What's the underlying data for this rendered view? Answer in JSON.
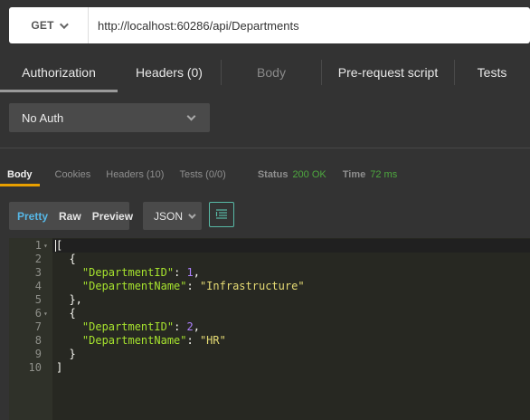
{
  "request": {
    "method": "GET",
    "url": "http://localhost:60286/api/Departments"
  },
  "request_tabs": [
    {
      "label": "Authorization",
      "state": "active"
    },
    {
      "label": "Headers (0)",
      "state": "normal"
    },
    {
      "label": "Body",
      "state": "disabled"
    },
    {
      "label": "Pre-request script",
      "state": "normal"
    },
    {
      "label": "Tests",
      "state": "normal"
    }
  ],
  "auth": {
    "selected": "No Auth"
  },
  "response_tabs": [
    {
      "label": "Body",
      "state": "active"
    },
    {
      "label": "Cookies",
      "state": "normal"
    },
    {
      "label": "Headers (10)",
      "state": "normal"
    },
    {
      "label": "Tests (0/0)",
      "state": "normal"
    }
  ],
  "response_meta": {
    "status_label": "Status",
    "status_value": "200 OK",
    "time_label": "Time",
    "time_value": "72 ms"
  },
  "view_modes": [
    "Pretty",
    "Raw",
    "Preview"
  ],
  "active_view_mode": "Pretty",
  "format": "JSON",
  "colors": {
    "accent_tab": "#e8a000",
    "status_ok": "#4ea83f",
    "pretty_active": "#56b7e6",
    "json_key": "#a6e22e",
    "json_number": "#ae81ff",
    "json_string": "#e6db74"
  },
  "icons": {
    "method_dropdown": "chevron-down-icon",
    "auth_dropdown": "chevron-down-icon",
    "format_dropdown": "chevron-down-icon",
    "wrap_toggle": "text-wrap-icon"
  },
  "editor": {
    "lines": [
      {
        "num": "1",
        "fold": true,
        "tokens": [
          {
            "t": "p",
            "v": "["
          }
        ]
      },
      {
        "num": "2",
        "fold": false,
        "tokens": [
          {
            "t": "p",
            "v": "  {"
          }
        ]
      },
      {
        "num": "3",
        "fold": false,
        "tokens": [
          {
            "t": "p",
            "v": "    "
          },
          {
            "t": "k",
            "v": "\"DepartmentID\""
          },
          {
            "t": "p",
            "v": ": "
          },
          {
            "t": "n",
            "v": "1"
          },
          {
            "t": "p",
            "v": ","
          }
        ]
      },
      {
        "num": "4",
        "fold": false,
        "tokens": [
          {
            "t": "p",
            "v": "    "
          },
          {
            "t": "k",
            "v": "\"DepartmentName\""
          },
          {
            "t": "p",
            "v": ": "
          },
          {
            "t": "s",
            "v": "\"Infrastructure\""
          }
        ]
      },
      {
        "num": "5",
        "fold": false,
        "tokens": [
          {
            "t": "p",
            "v": "  },"
          }
        ]
      },
      {
        "num": "6",
        "fold": true,
        "tokens": [
          {
            "t": "p",
            "v": "  {"
          }
        ]
      },
      {
        "num": "7",
        "fold": false,
        "tokens": [
          {
            "t": "p",
            "v": "    "
          },
          {
            "t": "k",
            "v": "\"DepartmentID\""
          },
          {
            "t": "p",
            "v": ": "
          },
          {
            "t": "n",
            "v": "2"
          },
          {
            "t": "p",
            "v": ","
          }
        ]
      },
      {
        "num": "8",
        "fold": false,
        "tokens": [
          {
            "t": "p",
            "v": "    "
          },
          {
            "t": "k",
            "v": "\"DepartmentName\""
          },
          {
            "t": "p",
            "v": ": "
          },
          {
            "t": "s",
            "v": "\"HR\""
          }
        ]
      },
      {
        "num": "9",
        "fold": false,
        "tokens": [
          {
            "t": "p",
            "v": "  }"
          }
        ]
      },
      {
        "num": "10",
        "fold": false,
        "tokens": [
          {
            "t": "p",
            "v": "]"
          }
        ]
      }
    ]
  }
}
